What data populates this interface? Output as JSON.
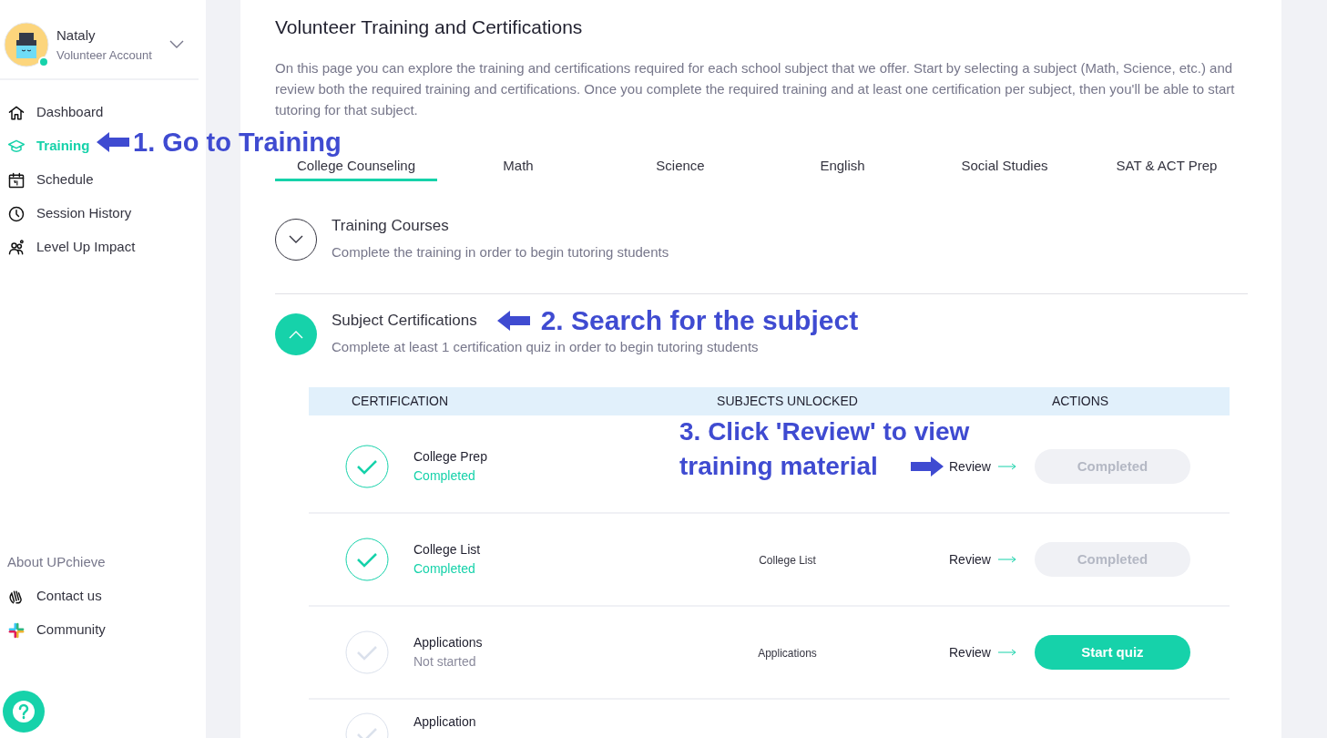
{
  "user": {
    "name": "Nataly",
    "role": "Volunteer Account",
    "online": true
  },
  "nav": [
    {
      "label": "Dashboard",
      "selected": false
    },
    {
      "label": "Training",
      "selected": true
    },
    {
      "label": "Schedule",
      "selected": false
    },
    {
      "label": "Session History",
      "selected": false
    },
    {
      "label": "Level Up Impact",
      "selected": false
    }
  ],
  "about": {
    "title": "About UPchieve",
    "links": [
      {
        "label": "Contact us"
      },
      {
        "label": "Community"
      }
    ]
  },
  "page": {
    "title": "Volunteer Training and Certifications",
    "intro": "On this page you can explore the training and certifications required for each school subject that we offer. Start by selecting a subject (Math, Science, etc.) and review both the required training and certifications. Once you complete the required training and at least one certification per subject, then you'll be able to start tutoring for that subject."
  },
  "tabs": [
    {
      "label": "College Counseling",
      "selected": true
    },
    {
      "label": "Math",
      "selected": false
    },
    {
      "label": "Science",
      "selected": false
    },
    {
      "label": "English",
      "selected": false
    },
    {
      "label": "Social Studies",
      "selected": false
    },
    {
      "label": "SAT & ACT Prep",
      "selected": false
    }
  ],
  "sections": [
    {
      "title": "Training Courses",
      "subtitle": "Complete the training in order to begin tutoring students",
      "expanded": false
    },
    {
      "title": "Subject Certifications",
      "subtitle": "Complete at least 1 certification quiz in order to begin tutoring students",
      "expanded": true
    }
  ],
  "table": {
    "columns": [
      "CERTIFICATION",
      "SUBJECTS UNLOCKED",
      "ACTIONS"
    ],
    "rows": [
      {
        "name": "College Prep",
        "status": "Completed",
        "completed": true,
        "review": "Review",
        "action": "Completed"
      },
      {
        "name": "College List",
        "status": "Completed",
        "completed": true,
        "subject": "College List",
        "review": "Review",
        "action": "Completed"
      },
      {
        "name": "Applications",
        "status": "Not started",
        "completed": false,
        "subject": "Applications",
        "review": "Review",
        "action": "Start quiz"
      },
      {
        "name": "Application",
        "completed": false
      }
    ]
  },
  "annotations": [
    {
      "text": "1. Go to Training"
    },
    {
      "text": "2. Search for the subject"
    },
    {
      "lines": [
        "3. Click 'Review' to view",
        "training material"
      ]
    }
  ]
}
